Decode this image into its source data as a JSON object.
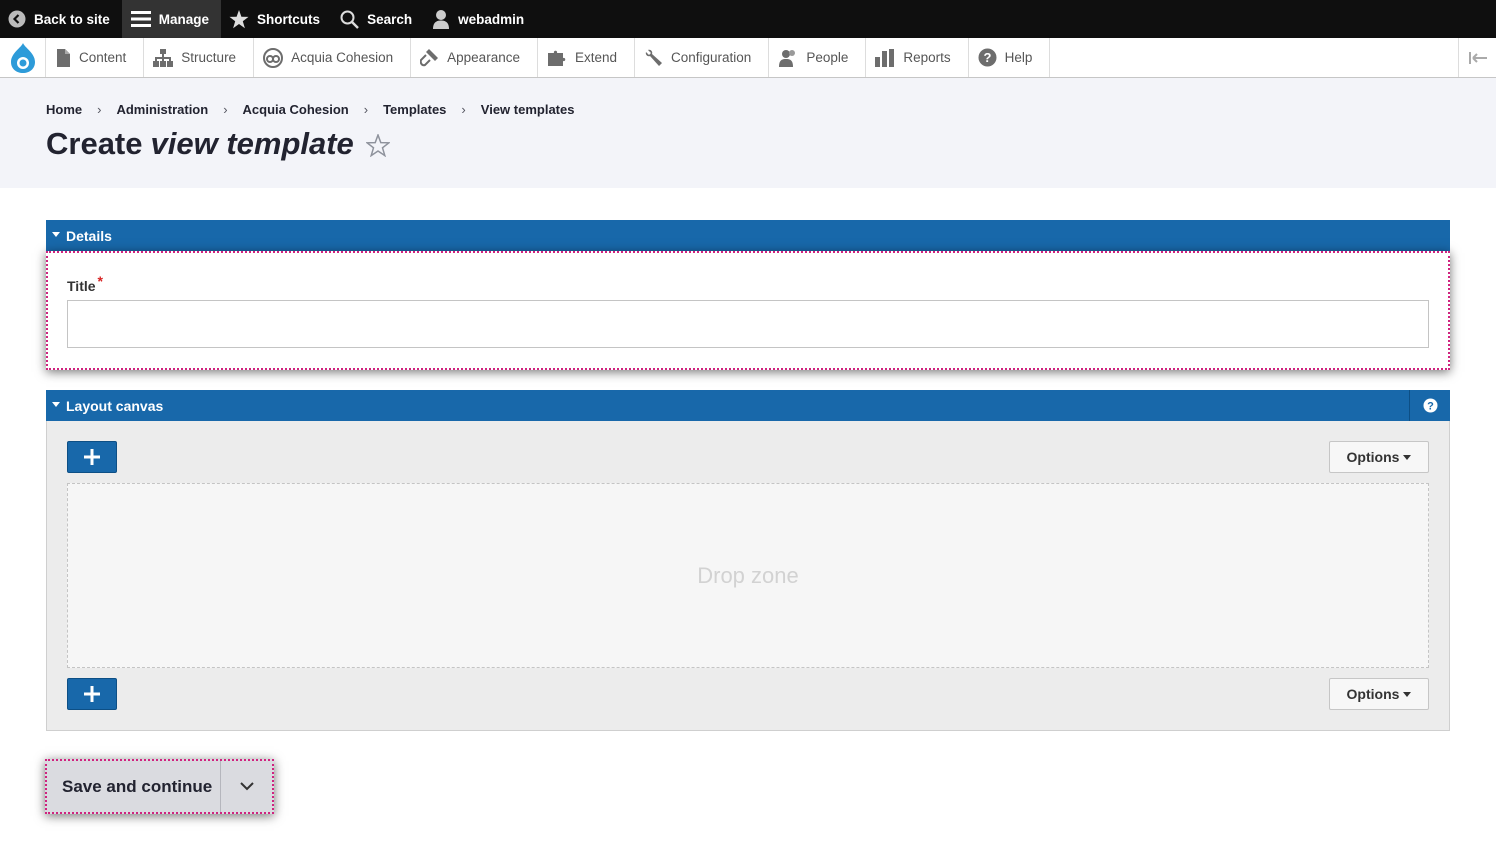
{
  "toolbar": {
    "back_label": "Back to site",
    "manage_label": "Manage",
    "shortcuts_label": "Shortcuts",
    "search_label": "Search",
    "user_label": "webadmin"
  },
  "tray": {
    "items": [
      {
        "label": "Content",
        "icon": "document-icon"
      },
      {
        "label": "Structure",
        "icon": "sitemap-icon"
      },
      {
        "label": "Acquia Cohesion",
        "icon": "cohesion-icon"
      },
      {
        "label": "Appearance",
        "icon": "paintbrush-icon"
      },
      {
        "label": "Extend",
        "icon": "puzzle-icon"
      },
      {
        "label": "Configuration",
        "icon": "wrench-icon"
      },
      {
        "label": "People",
        "icon": "people-icon"
      },
      {
        "label": "Reports",
        "icon": "bar-chart-icon"
      },
      {
        "label": "Help",
        "icon": "help-icon"
      }
    ]
  },
  "breadcrumb": [
    "Home",
    "Administration",
    "Acquia Cohesion",
    "Templates",
    "View templates"
  ],
  "breadcrumb_separator": "›",
  "page_title": {
    "normal": "Create",
    "emphasis": "view template"
  },
  "details": {
    "heading": "Details",
    "title_label": "Title",
    "required_mark": "*",
    "title_value": ""
  },
  "layout_canvas": {
    "heading": "Layout canvas",
    "add_label": "+",
    "options_label": "Options",
    "drop_zone_label": "Drop zone"
  },
  "actions": {
    "save_label": "Save and continue"
  },
  "colors": {
    "accent": "#1868aa",
    "toolbar_bg": "#0f0f0f",
    "focus_outline": "#d0237f"
  }
}
